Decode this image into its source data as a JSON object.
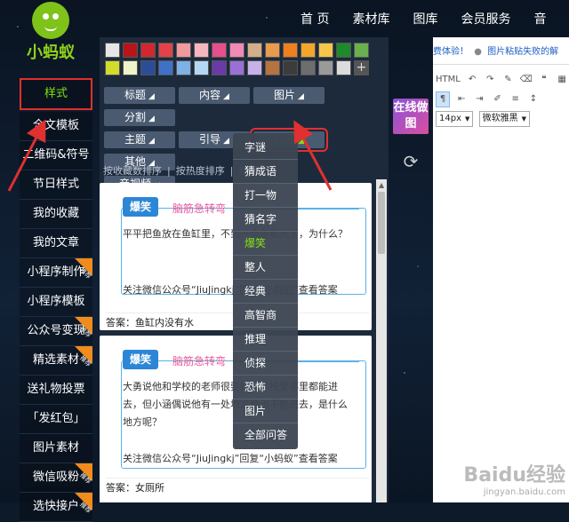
{
  "nav": [
    "首 页",
    "素材库",
    "图库",
    "会员服务",
    "音"
  ],
  "logo": {
    "text": "小蚂蚁"
  },
  "sidebar": {
    "items": [
      {
        "label": "样式",
        "active": true,
        "hot": false
      },
      {
        "label": "全文模板",
        "hot": false
      },
      {
        "label": "二维码&符号",
        "hot": false
      },
      {
        "label": "节日样式",
        "hot": false
      },
      {
        "label": "我的收藏",
        "hot": false
      },
      {
        "label": "我的文章",
        "hot": false
      },
      {
        "label": "小程序制作",
        "hot": true
      },
      {
        "label": "小程序模板",
        "hot": false
      },
      {
        "label": "公众号变现",
        "hot": true
      },
      {
        "label": "精选素材",
        "hot": true
      },
      {
        "label": "送礼物投票",
        "hot": false
      },
      {
        "label": "「发红包」",
        "hot": false
      },
      {
        "label": "图片素材",
        "hot": false
      },
      {
        "label": "微信吸粉",
        "hot": true
      },
      {
        "label": "选快接户",
        "hot": true
      }
    ],
    "hot_label": "推荐"
  },
  "colors": {
    "row1": [
      "#e6e6e6",
      "#b8151b",
      "#d0282e",
      "#e2434a",
      "#f09a9e",
      "#f4b7c0",
      "#e64f8c",
      "#ef8ab5",
      "#d4ae8a",
      "#e89a4d",
      "#f07f1e",
      "#f2a72a",
      "#f5c64a",
      "#1d8a2c",
      "#6ab04c"
    ],
    "row2": [
      "#d2dc2a",
      "#eef4c8",
      "#2b4c99",
      "#3f71c9",
      "#7fb0e8",
      "#b5d7f4",
      "#6a3aa8",
      "#9c6fd6",
      "#c9b2ea",
      "#b7733f",
      "#3c3c3c",
      "#6e6e6e",
      "#9a9a9a",
      "#dcdcdc"
    ],
    "plus": "+"
  },
  "tabs": {
    "row1": [
      {
        "label": "标题",
        "arrow": "◢"
      },
      {
        "label": "内容",
        "arrow": "◢"
      },
      {
        "label": "图片",
        "arrow": "◢"
      },
      {
        "label": "分割",
        "arrow": "◢"
      }
    ],
    "row2": [
      {
        "label": "主题",
        "arrow": "◢"
      },
      {
        "label": "引导",
        "arrow": "◢"
      },
      {
        "label": "问答",
        "arrow": "◢",
        "active": true
      },
      {
        "label": "其他",
        "arrow": "◢"
      }
    ],
    "row3": [
      {
        "label": "音视频",
        "arrow": "◢"
      }
    ]
  },
  "sortbar": [
    "按收藏数排序",
    "|",
    "按热度排序",
    "|",
    "按",
    "更..."
  ],
  "dropdown": {
    "items": [
      "字谜",
      "猜成语",
      "打一物",
      "猜名字",
      "爆笑",
      "整人",
      "经典",
      "高智商",
      "推理",
      "侦探",
      "恐怖",
      "图片",
      "全部问答"
    ],
    "selected": "爆笑"
  },
  "cards": [
    {
      "badge": "爆笑",
      "category": "脑筋急转弯",
      "question": "平平把鱼放在鱼缸里，不到一会鱼都死了，为什么？",
      "note": "关注微信公众号“JiuJingkj”回复“小蚂蚁”查看答案",
      "answer": "答案：鱼缸内没有水"
    },
    {
      "badge": "爆笑",
      "category": "脑筋急转弯",
      "question": "大勇说他和学校的老师很要好，学校里哪里都能进去，但小涵偶说他有一处地方他也不能进去，是什么地方呢？",
      "note": "关注微信公众号“JiuJingkj”回复“小蚂蚁”查看答案",
      "answer": "答案：女厕所"
    }
  ],
  "online_button": "在线做图",
  "right": {
    "notice_a": "费体验！",
    "notice_b": "图片粘贴失败的解",
    "font_size": "14px",
    "font_family": "微软雅黑"
  },
  "watermark": {
    "main": "Baidu经验",
    "sub": "jingyan.baidu.com"
  }
}
